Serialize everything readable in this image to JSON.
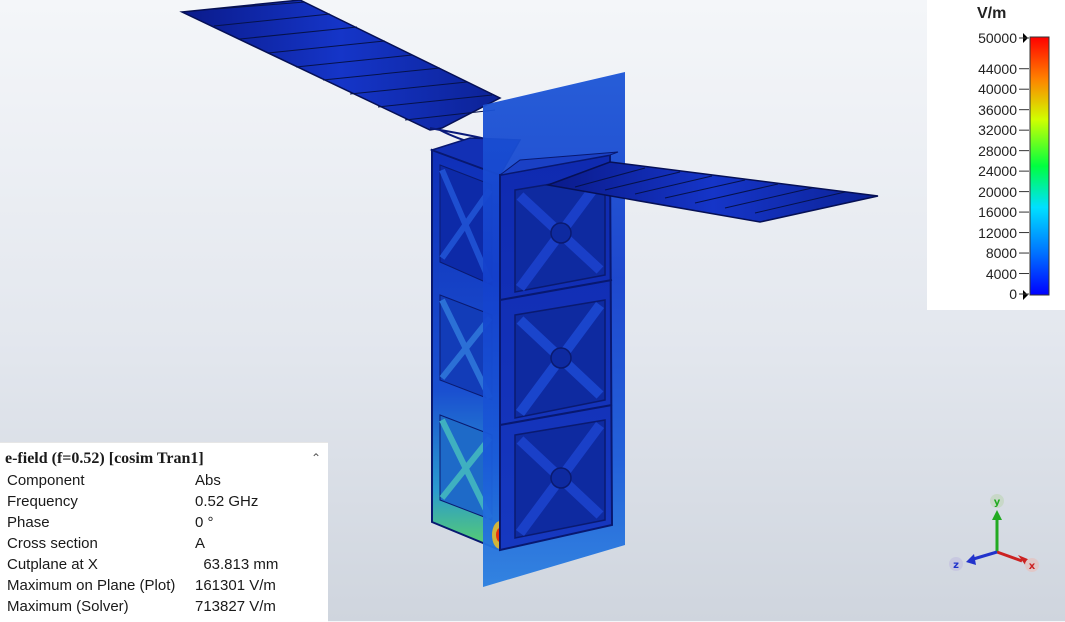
{
  "legend": {
    "unit": "V/m",
    "ticks": [
      "50000",
      "44000",
      "40000",
      "36000",
      "32000",
      "28000",
      "24000",
      "20000",
      "16000",
      "12000",
      "8000",
      "4000",
      "0"
    ],
    "colorscale": [
      "#ff0000",
      "#ff8000",
      "#ffff00",
      "#00ff00",
      "#00ffff",
      "#0080ff",
      "#0000ff"
    ]
  },
  "info": {
    "title": "e-field (f=0.52) [cosim Tran1]",
    "rows": [
      {
        "label": "Component",
        "value": "Abs"
      },
      {
        "label": "Frequency",
        "value": "0.52 GHz"
      },
      {
        "label": "Phase",
        "value": "0 °"
      },
      {
        "label": "Cross section",
        "value": "A"
      },
      {
        "label": "Cutplane at X",
        "value": "  63.813 mm"
      },
      {
        "label": "Maximum on Plane (Plot)",
        "value": "161301 V/m"
      },
      {
        "label": "Maximum (Solver)",
        "value": "713827 V/m"
      }
    ]
  },
  "axes": {
    "x": "x",
    "y": "y",
    "z": "z"
  },
  "colors": {
    "field_low": "#1030c0",
    "field_mid": "#1a7fd0",
    "axis_x": "#cc2222",
    "axis_y": "#22aa22",
    "axis_z": "#2233cc"
  }
}
